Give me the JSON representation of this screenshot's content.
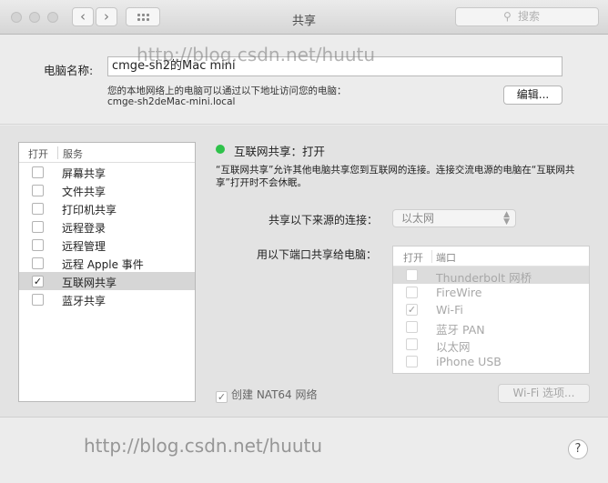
{
  "window": {
    "title": "共享"
  },
  "toolbar": {
    "back_label": "‹",
    "forward_label": "›",
    "search_placeholder": "搜索"
  },
  "computer_name": {
    "label": "电脑名称:",
    "value": "cmge-sh2的Mac mini",
    "hint": "您的本地网络上的电脑可以通过以下地址访问您的电脑：",
    "hostname": "cmge-sh2deMac-mini.local",
    "edit_label": "编辑..."
  },
  "services": {
    "col_on": "打开",
    "col_service": "服务",
    "items": [
      {
        "label": "屏幕共享",
        "checked": false
      },
      {
        "label": "文件共享",
        "checked": false
      },
      {
        "label": "打印机共享",
        "checked": false
      },
      {
        "label": "远程登录",
        "checked": false
      },
      {
        "label": "远程管理",
        "checked": false
      },
      {
        "label": "远程 Apple 事件",
        "checked": false
      },
      {
        "label": "互联网共享",
        "checked": true
      },
      {
        "label": "蓝牙共享",
        "checked": false
      }
    ],
    "selected_index": 6
  },
  "detail": {
    "status": "互联网共享：打开",
    "status_color": "#2ec24a",
    "description": "“互联网共享”允许其他电脑共享您到互联网的连接。连接交流电源的电脑在“互联网共享”打开时不会休眠。",
    "from_label": "共享以下来源的连接：",
    "from_value": "以太网",
    "to_label": "用以下端口共享给电脑：",
    "ports_col_on": "打开",
    "ports_col_port": "端口",
    "ports": [
      {
        "label": "Thunderbolt 网桥",
        "checked": false
      },
      {
        "label": "FireWire",
        "checked": false
      },
      {
        "label": "Wi-Fi",
        "checked": true
      },
      {
        "label": "蓝牙 PAN",
        "checked": false
      },
      {
        "label": "以太网",
        "checked": false
      },
      {
        "label": "iPhone USB",
        "checked": false
      }
    ],
    "nat64_label": "创建 NAT64 网络",
    "nat64_checked": true,
    "wifi_options_label": "Wi-Fi 选项..."
  },
  "help_label": "?",
  "watermark": "http://blog.csdn.net/huutu"
}
